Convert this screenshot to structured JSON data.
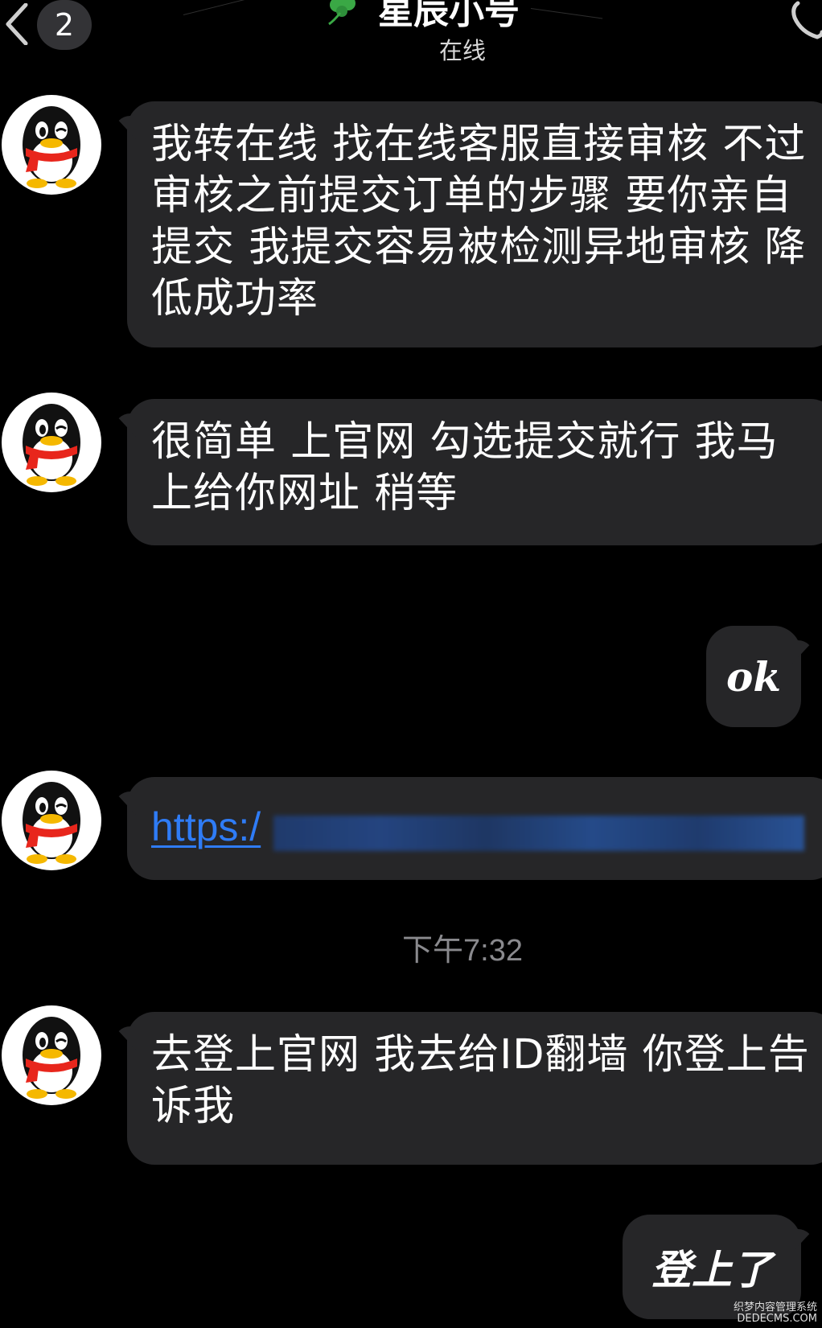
{
  "header": {
    "back_badge": "2",
    "title": "星辰小号",
    "status": "在线"
  },
  "messages": [
    {
      "side": "in",
      "text": "我转在线 找在线客服直接审核   不过审核之前提交订单的步骤 要你亲自提交 我提交容易被检测异地审核 降低成功率"
    },
    {
      "side": "in",
      "text": "很简单 上官网 勾选提交就行 我马上给你网址  稍等"
    },
    {
      "side": "out",
      "text": "ok"
    },
    {
      "side": "in",
      "text": "https:/",
      "type": "link"
    },
    {
      "side": "in",
      "text": "去登上官网 我去给ID翻墙 你登上告诉我"
    },
    {
      "side": "out",
      "text": "登上了"
    }
  ],
  "timestamp": "下午7:32",
  "watermark": {
    "line1": "织梦内容管理系统",
    "line2": "DEDECMS.COM"
  },
  "colors": {
    "background": "#000000",
    "bubble": "#262628",
    "link": "#2f7cf6",
    "badge": "#333336",
    "timestamp": "#8a8a8e"
  }
}
